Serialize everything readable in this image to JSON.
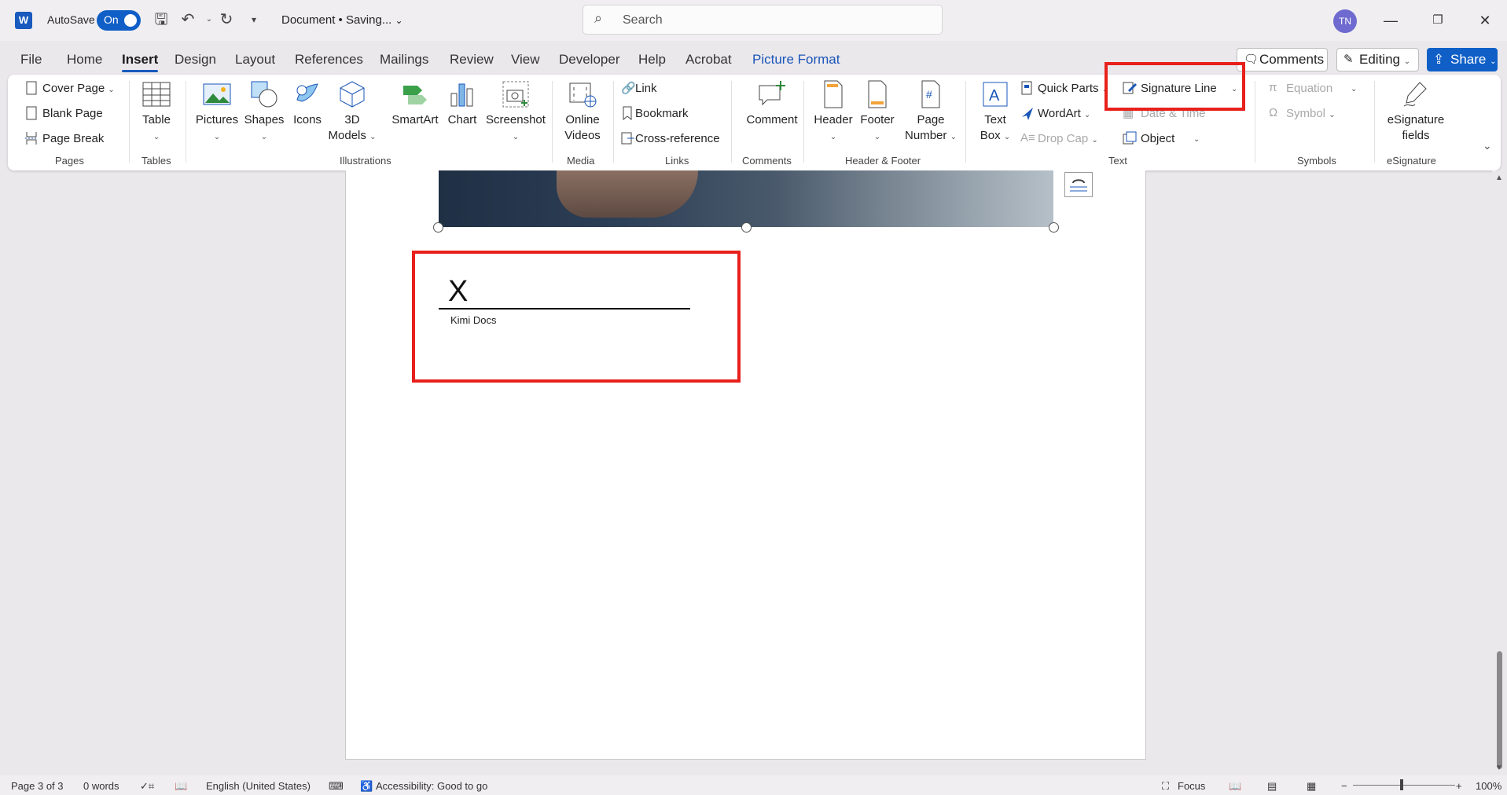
{
  "titlebar": {
    "autosave_label": "AutoSave",
    "autosave_state": "On",
    "doc_title": "Document • Saving...",
    "search_placeholder": "Search",
    "avatar_initials": "TN"
  },
  "menu": {
    "tabs": [
      "File",
      "Home",
      "Insert",
      "Design",
      "Layout",
      "References",
      "Mailings",
      "Review",
      "View",
      "Developer",
      "Help",
      "Acrobat",
      "Picture Format"
    ],
    "comments_label": "Comments",
    "editing_label": "Editing",
    "share_label": "Share"
  },
  "ribbon": {
    "pages": {
      "cover_page": "Cover Page",
      "blank_page": "Blank Page",
      "page_break": "Page Break",
      "group": "Pages"
    },
    "tables": {
      "table": "Table",
      "group": "Tables"
    },
    "illustrations": {
      "pictures": "Pictures",
      "shapes": "Shapes",
      "icons": "Icons",
      "models_line1": "3D",
      "models_line2": "Models",
      "smartart": "SmartArt",
      "chart": "Chart",
      "screenshot": "Screenshot",
      "group": "Illustrations"
    },
    "media": {
      "line1": "Online",
      "line2": "Videos",
      "group": "Media"
    },
    "links": {
      "link": "Link",
      "bookmark": "Bookmark",
      "cross_reference": "Cross-reference",
      "group": "Links"
    },
    "comments": {
      "comment": "Comment",
      "group": "Comments"
    },
    "header_footer": {
      "header": "Header",
      "footer": "Footer",
      "page_line1": "Page",
      "page_line2": "Number",
      "group": "Header & Footer"
    },
    "text": {
      "textbox_line1": "Text",
      "textbox_line2": "Box",
      "quick_parts": "Quick Parts",
      "wordart": "WordArt",
      "drop_cap": "Drop Cap",
      "signature_line": "Signature Line",
      "date_time": "Date & Time",
      "object": "Object",
      "group": "Text"
    },
    "symbols": {
      "equation": "Equation",
      "symbol": "Symbol",
      "group": "Symbols"
    },
    "esignature": {
      "line1": "eSignature",
      "line2": "fields",
      "group": "eSignature"
    }
  },
  "document": {
    "signature_x": "X",
    "signer_name": "Kimi Docs"
  },
  "statusbar": {
    "page": "Page 3 of 3",
    "words": "0 words",
    "language": "English (United States)",
    "accessibility": "Accessibility: Good to go",
    "focus": "Focus",
    "zoom": "100%"
  },
  "colors": {
    "accent": "#185abd",
    "highlight": "#e8201b",
    "share": "#0f5fc7"
  }
}
